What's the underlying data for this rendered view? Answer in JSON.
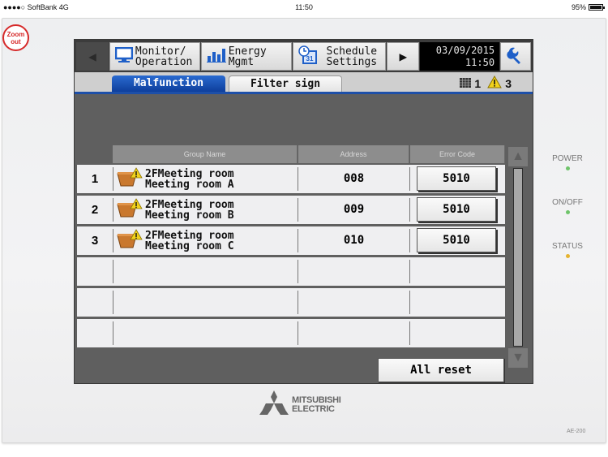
{
  "status_bar": {
    "carrier": "●●●●○ SoftBank  4G",
    "time": "11:50",
    "battery": "95%"
  },
  "zoom_out": {
    "line1": "Zoom",
    "line2": "out"
  },
  "nav": {
    "monitor": {
      "line1": "Monitor/",
      "line2": "Operation",
      "icon": "monitor-icon"
    },
    "energy": {
      "line1": "Energy",
      "line2": "Mgmt",
      "icon": "bar-chart-icon"
    },
    "schedule": {
      "line1": "Schedule",
      "line2": "Settings",
      "icon": "calendar-clock-icon",
      "badge": "31"
    },
    "date": "03/09/2015",
    "time": "11:50"
  },
  "tabs": {
    "active": "Malfunction",
    "inactive": "Filter sign"
  },
  "counts": {
    "filter_count": "1",
    "alert_count": "3"
  },
  "table": {
    "headers": [
      "Group Name",
      "Address",
      "Error Code"
    ],
    "rows": [
      {
        "num": "1",
        "name1": "2FMeeting room",
        "name2": "Meeting room A",
        "address": "008",
        "error": "5010"
      },
      {
        "num": "2",
        "name1": "2FMeeting room",
        "name2": "Meeting room B",
        "address": "009",
        "error": "5010"
      },
      {
        "num": "3",
        "name1": "2FMeeting room",
        "name2": "Meeting room C",
        "address": "010",
        "error": "5010"
      }
    ]
  },
  "footer": {
    "all_reset": "All reset"
  },
  "leds": [
    {
      "label": "POWER",
      "color": "#6fc46a"
    },
    {
      "label": "ON/OFF",
      "color": "#6fc46a"
    },
    {
      "label": "STATUS",
      "color": "#e5b330"
    }
  ],
  "brand": {
    "line1": "MITSUBISHI",
    "line2": "ELECTRIC",
    "model": "AE-200"
  },
  "colors": {
    "accent_blue": "#1d4fa8",
    "warning_yellow": "#f2d21b",
    "zoom_red": "#d62a2a"
  }
}
